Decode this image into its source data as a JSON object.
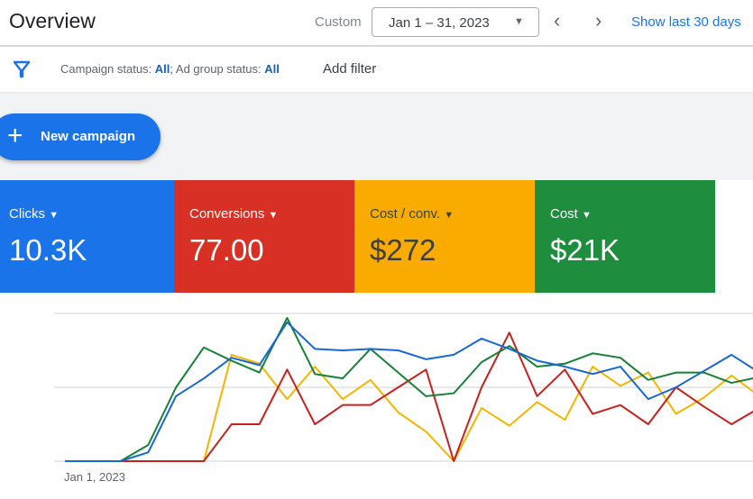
{
  "header": {
    "title": "Overview",
    "range_type": "Custom",
    "date_range": "Jan 1 – 31, 2023",
    "show_last": "Show last 30 days"
  },
  "filter": {
    "campaign_label": "Campaign status: ",
    "campaign_value": "All",
    "sep": "; ",
    "adgroup_label": "Ad group status: ",
    "adgroup_value": "All",
    "add_filter": "Add filter"
  },
  "new_campaign": "New campaign",
  "metrics": [
    {
      "label": "Clicks",
      "value": "10.3K",
      "color": "#1a73e8",
      "text_color": "#ffffff"
    },
    {
      "label": "Conversions",
      "value": "77.00",
      "color": "#d93025",
      "text_color": "#ffffff"
    },
    {
      "label": "Cost / conv.",
      "value": "$272",
      "color": "#f9ab00",
      "text_color": "#3c4043"
    },
    {
      "label": "Cost",
      "value": "$21K",
      "color": "#1e8e3e",
      "text_color": "#ffffff"
    }
  ],
  "chart_data": {
    "type": "line",
    "x_start_label": "Jan 1, 2023",
    "grid": true,
    "ylim": [
      0,
      100
    ],
    "series": [
      {
        "color": "#1967d2",
        "values": [
          0,
          0,
          0,
          6,
          44,
          56,
          70,
          65,
          94,
          76,
          75,
          76,
          75,
          69,
          72,
          83,
          76,
          68,
          64,
          59,
          64,
          42,
          50,
          61,
          72,
          60
        ]
      },
      {
        "color": "#188038",
        "values": [
          0,
          0,
          0,
          11,
          50,
          77,
          68,
          60,
          97,
          59,
          56,
          76,
          60,
          44,
          46,
          67,
          78,
          64,
          66,
          73,
          70,
          55,
          60,
          60,
          53,
          57
        ]
      },
      {
        "color": "#f2b600",
        "values": [
          0,
          0,
          0,
          0,
          0,
          0,
          72,
          66,
          42,
          64,
          42,
          55,
          33,
          20,
          0,
          36,
          24,
          40,
          28,
          64,
          51,
          60,
          32,
          43,
          58,
          44
        ]
      },
      {
        "color": "#c5221f",
        "values": [
          0,
          0,
          0,
          0,
          0,
          0,
          25,
          25,
          62,
          25,
          38,
          38,
          50,
          62,
          0,
          50,
          87,
          44,
          62,
          32,
          38,
          25,
          50,
          37,
          25,
          36
        ]
      }
    ]
  }
}
